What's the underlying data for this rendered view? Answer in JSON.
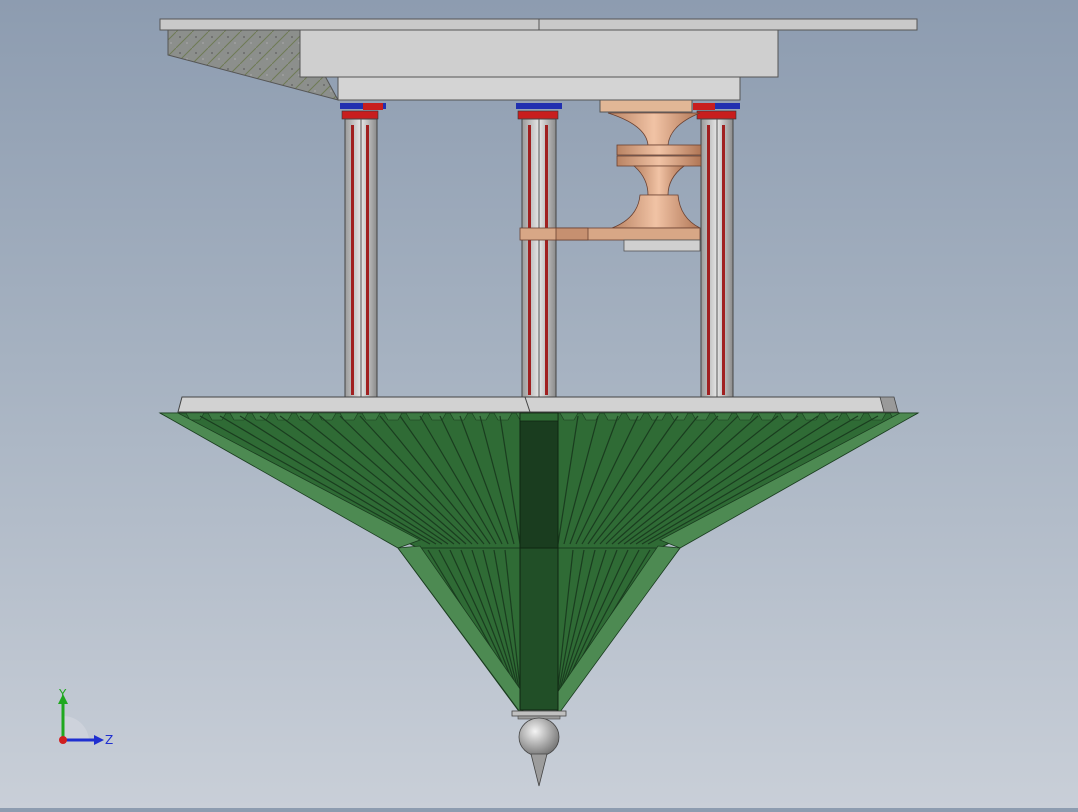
{
  "triad": {
    "y_label": "Y",
    "z_label": "Z"
  },
  "colors": {
    "background_top": "#8d9cb0",
    "background_bottom": "#c9cfd8",
    "deck_grey": "#c8c8c8",
    "deck_edge": "#555555",
    "column_grey": "#d2d2d2",
    "column_red": "#a02020",
    "bearing_red": "#c81e1e",
    "bearing_blue": "#2030b0",
    "copper": "#d19a78",
    "cone_green": "#2f6b35",
    "cone_dark": "#1a3d1f",
    "cone_light": "#4d8a52",
    "ball_grey": "#bcbcbc",
    "axis_y": "#1fa81f",
    "axis_z": "#1f2fd0",
    "axis_x": "#d01f1f"
  },
  "icons": {
    "triad": "coordinate-triad-icon"
  }
}
